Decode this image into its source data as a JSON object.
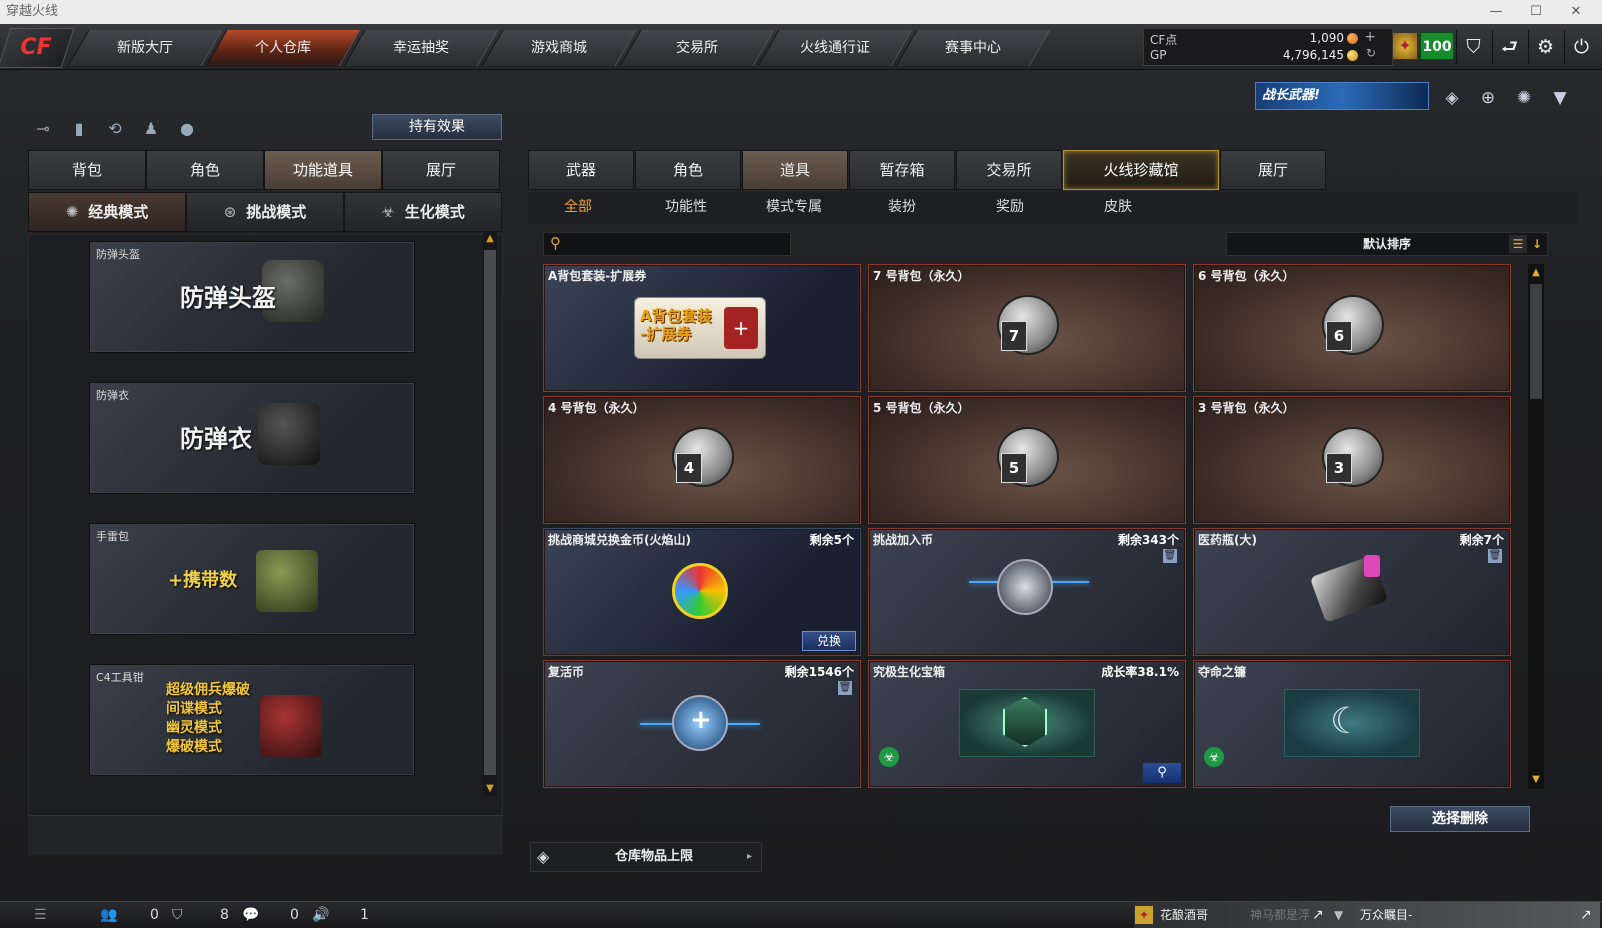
{
  "window": {
    "title": "穿越火线"
  },
  "nav": {
    "tabs": [
      "新版大厅",
      "个人仓库",
      "幸运抽奖",
      "游戏商城",
      "交易所",
      "火线通行证",
      "赛事中心"
    ],
    "active_index": 1
  },
  "currency": {
    "cf_label": "CF点",
    "cf_value": "1,090",
    "gp_label": "GP",
    "gp_value": "4,796,145",
    "level": "100"
  },
  "growth_banner": "战长武器!",
  "left": {
    "hold_effect": "持有效果",
    "tabs": [
      "背包",
      "角色",
      "功能道具",
      "展厅"
    ],
    "active_tab": "功能道具",
    "modes": [
      "经典模式",
      "挑战模式",
      "生化模式"
    ],
    "items": [
      {
        "caption": "防弹头盔",
        "big": "防弹头盔"
      },
      {
        "caption": "防弹衣",
        "big": "防弹衣"
      },
      {
        "caption": "手雷包",
        "big": "+携带数"
      },
      {
        "caption": "C4工具钳",
        "big": "超级佣兵爆破\n间谍模式\n幽灵模式\n爆破模式"
      }
    ]
  },
  "right": {
    "tabs": [
      "武器",
      "角色",
      "道具",
      "暂存箱",
      "交易所",
      "火线珍藏馆",
      "展厅"
    ],
    "active_tab": "道具",
    "subtabs": [
      "全部",
      "功能性",
      "模式专属",
      "装扮",
      "奖励",
      "皮肤"
    ],
    "active_subtab": "全部",
    "search_placeholder": "",
    "sort": "默认排序",
    "cards": [
      {
        "name": "A背包套装-扩展券",
        "art_text": "A背包套装\n-扩展券"
      },
      {
        "name": "7 号背包（永久）",
        "bag": "7"
      },
      {
        "name": "6 号背包（永久）",
        "bag": "6"
      },
      {
        "name": "4 号背包（永久）",
        "bag": "4"
      },
      {
        "name": "5 号背包（永久）",
        "bag": "5"
      },
      {
        "name": "3 号背包（永久）",
        "bag": "3"
      },
      {
        "name": "挑战商城兑换金币(火焰山)",
        "remaining": "剩余5个",
        "button": "兑换"
      },
      {
        "name": "挑战加入币",
        "remaining": "剩余343个"
      },
      {
        "name": "医药瓶(大)",
        "remaining": "剩余7个"
      },
      {
        "name": "复活币",
        "remaining": "剩余1546个"
      },
      {
        "name": "究极生化宝箱",
        "remaining": "成长率38.1%"
      },
      {
        "name": "夺命之镰",
        "remaining": ""
      }
    ],
    "delete_button": "选择删除",
    "store_limit": "仓库物品上限"
  },
  "bottom": {
    "count1": "0",
    "count2": "8",
    "count3": "0",
    "count4": "1",
    "track1": "花酿酒哥",
    "track1b": "神马都是浮",
    "track2": "万众瞩目-"
  }
}
